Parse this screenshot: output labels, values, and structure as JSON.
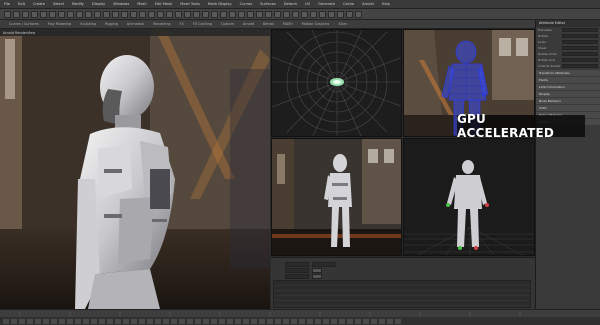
{
  "menu": {
    "items": [
      "File",
      "Edit",
      "Create",
      "Select",
      "Modify",
      "Display",
      "Windows",
      "Mesh",
      "Edit Mesh",
      "Mesh Tools",
      "Mesh Display",
      "Curves",
      "Surfaces",
      "Deform",
      "UV",
      "Generate",
      "Cache",
      "Arnold",
      "Help"
    ]
  },
  "shelf": {
    "tabs": [
      "Curves / Surfaces",
      "Poly Modeling",
      "Sculpting",
      "Rigging",
      "Animation",
      "Rendering",
      "FX",
      "FX Caching",
      "Custom",
      "Arnold",
      "Bifrost",
      "MASH",
      "Motion Graphics",
      "XGen"
    ]
  },
  "render_view": {
    "title": "Arnold RenderView"
  },
  "overlay": {
    "gpu_label": "GPU ACCELERATED"
  },
  "attribute_editor": {
    "title": "Attribute Editor",
    "sections": [
      "Transform Attributes",
      "Pivots",
      "Limit Information",
      "Display",
      "Node Behavior",
      "UUID",
      "Extra Attributes",
      "Arnold"
    ],
    "rows": [
      "Translate",
      "Rotate",
      "Scale",
      "Shear",
      "Rotate Order",
      "Rotate Axis",
      "Inherits Transform"
    ]
  },
  "lower_panel": {
    "list_rows": [
      "",
      "",
      "",
      "",
      ""
    ]
  },
  "colors": {
    "background": "#2b2b2b",
    "panel": "#3a3a3a",
    "overlay_bg": "#0a0a0a",
    "overlay_text": "#ffffff",
    "wireframe_blue": "#2a3adf",
    "grid": "#4a4a4a",
    "accent_green": "#9aca3c"
  }
}
